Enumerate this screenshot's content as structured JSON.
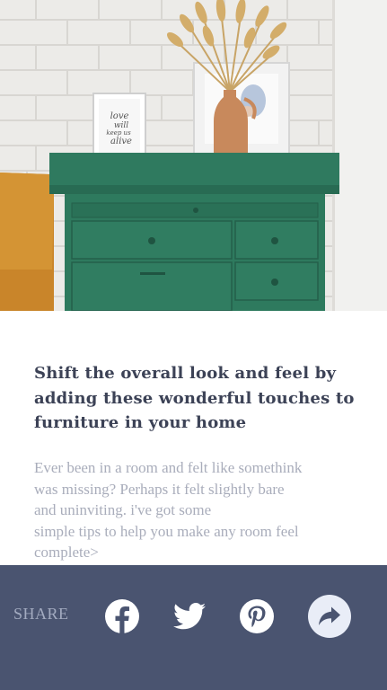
{
  "article": {
    "title": "Shift the overall look and feel by adding these wonderful touches to furniture in your home",
    "description_lines": [
      "Ever been in a room and felt like somethink",
      "was missing? Perhaps it felt slightly bare",
      "and uninviting. i've got some",
      "simple tips to help you make any room feel",
      "complete>"
    ],
    "hero_frame_text": [
      "love",
      "will",
      "keep us",
      "alive"
    ]
  },
  "share": {
    "label": "SHARE",
    "icons": [
      "facebook-icon",
      "twitter-icon",
      "pinterest-icon",
      "share-arrow-icon"
    ]
  },
  "colors": {
    "share_bar": "#4a5470",
    "title": "#3c4256",
    "description": "#a9adbb",
    "dresser": "#2f7a5f"
  }
}
